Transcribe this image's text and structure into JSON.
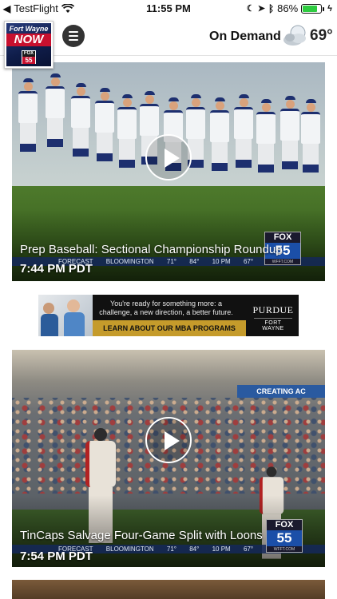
{
  "status_bar": {
    "back_app": "TestFlight",
    "time": "11:55 PM",
    "battery": "86%",
    "battery_level": 0.86
  },
  "header": {
    "logo_line1": "Fort Wayne",
    "logo_line2": "NOW",
    "logo_fox": "FOX",
    "logo_55": "55",
    "title": "On Demand",
    "temperature": "69°",
    "weather_icon": "partly-cloudy-night-icon"
  },
  "videos": [
    {
      "title": "Prep Baseball: Sectional Championship Roundup",
      "time": "7:44 PM PDT",
      "bug_fox": "FOX",
      "bug_num": "55",
      "bug_url": "WFFT.COM",
      "ticker": [
        "FORECAST",
        "BLOOMINGTON",
        "71°",
        "84°",
        "10 PM",
        "67°"
      ]
    },
    {
      "title": "TinCaps Salvage Four-Game Split with Loons",
      "time": "7:54 PM PDT",
      "bug_fox": "FOX",
      "bug_num": "55",
      "bug_url": "WFFT.COM",
      "ticker": [
        "FORECAST",
        "BLOOMINGTON",
        "71°",
        "84°",
        "10 PM",
        "67°"
      ],
      "banner": "CREATING AC"
    }
  ],
  "ad": {
    "text": "You're ready for something more: a challenge, a new direction, a better future.",
    "cta": "LEARN ABOUT OUR MBA PROGRAMS",
    "brand_line1": "PURDUE",
    "brand_line2": "FORT WAYNE"
  },
  "colors": {
    "accent_red": "#c8102e",
    "fox_blue": "#1b4fa8",
    "ad_gold": "#c59b2b",
    "battery_green": "#2ecc40"
  }
}
